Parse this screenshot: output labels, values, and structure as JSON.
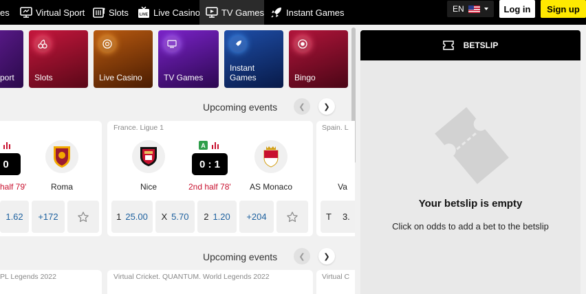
{
  "nav": {
    "items": [
      {
        "label": "es"
      },
      {
        "label": "Virtual Sport"
      },
      {
        "label": "Slots"
      },
      {
        "label": "Live Casino"
      },
      {
        "label": "TV Games"
      },
      {
        "label": "Instant Games"
      }
    ],
    "language": "EN",
    "login_label": "Log in",
    "signup_label": "Sign up",
    "live_icon_text": "LIVE"
  },
  "categories": [
    {
      "label": "port"
    },
    {
      "label": "Slots"
    },
    {
      "label": "Live Casino"
    },
    {
      "label": "TV Games"
    },
    {
      "label": "Instant Games"
    },
    {
      "label": "Bingo"
    }
  ],
  "sections": [
    {
      "title": "Upcoming events"
    },
    {
      "title": "Upcoming events"
    }
  ],
  "events": [
    {
      "league": "",
      "score": ": 0",
      "half": "half 79'",
      "team_away": "Roma",
      "odds": {
        "v2": "1.62",
        "more": "+172"
      }
    },
    {
      "league": "France. Ligue 1",
      "team_home": "Nice",
      "team_away": "AS Monaco",
      "score": "0 : 1",
      "half": "2nd half 78'",
      "a_badge": "A",
      "odds": {
        "l1": "1",
        "v1": "25.00",
        "lx": "X",
        "vx": "5.70",
        "l2": "2",
        "v2": "1.20",
        "more": "+204"
      }
    },
    {
      "league": "Spain. L",
      "team_home": "Va",
      "odds": {
        "l1": "T",
        "v1": "3."
      }
    }
  ],
  "second_row": [
    {
      "league": "PL Legends 2022"
    },
    {
      "league": "Virtual Cricket. QUANTUM. World Legends 2022"
    },
    {
      "league": "Virtual C"
    }
  ],
  "betslip": {
    "title": "BETSLIP",
    "empty_title": "Your betslip is empty",
    "empty_text": "Click on odds to add a bet to the betslip"
  },
  "colors": {
    "accent_yellow": "#ffe900",
    "live_red": "#c8102e",
    "odds_blue": "#1b5f9e",
    "badge_green": "#2e9e4a"
  }
}
